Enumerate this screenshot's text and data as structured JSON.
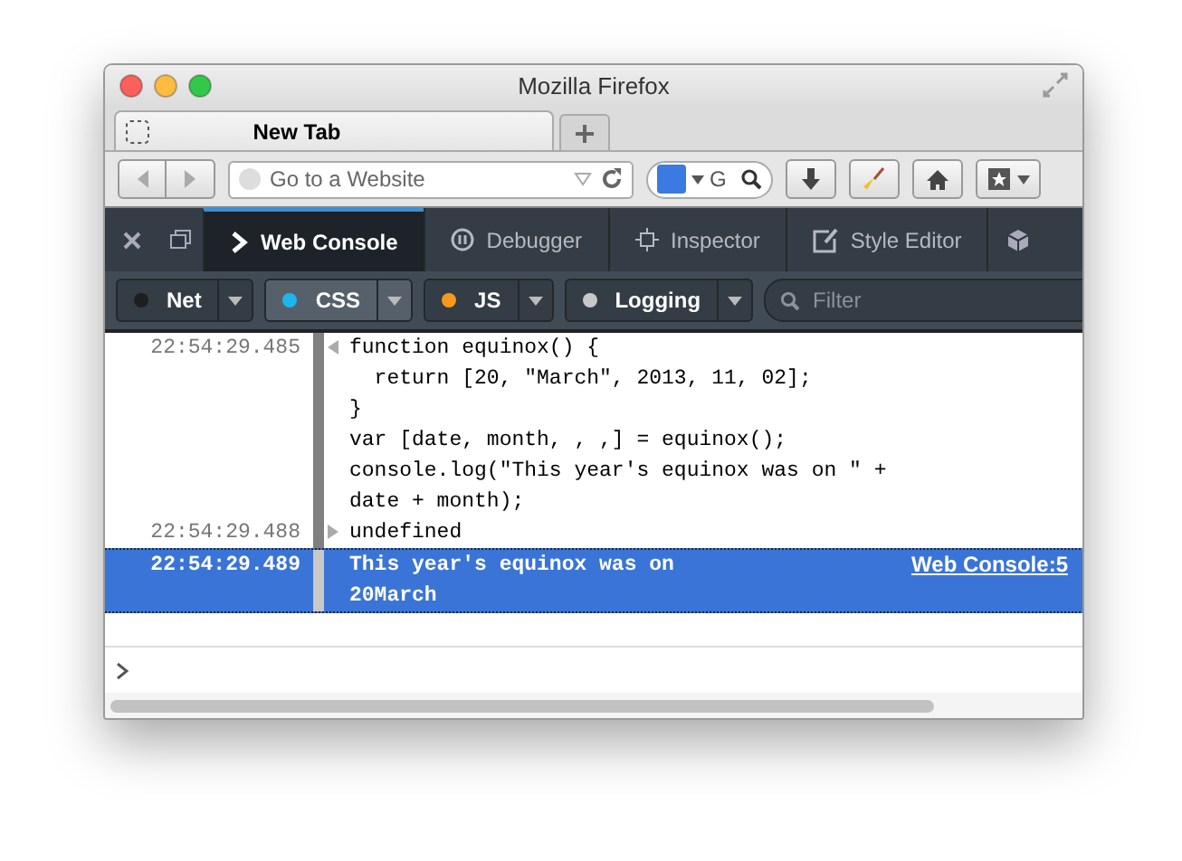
{
  "window": {
    "title": "Mozilla Firefox"
  },
  "tabs": [
    {
      "label": "New Tab",
      "selected": true
    }
  ],
  "navbar": {
    "address": {
      "placeholder": "Go to a Website"
    },
    "search": {
      "value": "G"
    }
  },
  "devtools_tabs": [
    {
      "label": "Web Console",
      "kind": "console",
      "selected": true
    },
    {
      "label": "Debugger",
      "kind": "debugger",
      "selected": false
    },
    {
      "label": "Inspector",
      "kind": "inspector",
      "selected": false
    },
    {
      "label": "Style Editor",
      "kind": "style",
      "selected": false
    }
  ],
  "filters": [
    {
      "label": "Net",
      "color": "#1e1e1e",
      "selected": false
    },
    {
      "label": "CSS",
      "color": "#1eb4f0",
      "selected": true
    },
    {
      "label": "JS",
      "color": "#f59a1a",
      "selected": false
    },
    {
      "label": "Logging",
      "color": "#c8c8c8",
      "selected": false
    }
  ],
  "filter_field": {
    "placeholder": "Filter"
  },
  "console": [
    {
      "kind": "input",
      "time": "22:54:29.485",
      "selected": false,
      "lines": [
        "function equinox() {",
        "  return [20, \"March\", 2013, 11, 02];",
        "}",
        "var [date, month, , ,] = equinox();",
        "console.log(\"This year's equinox was on \" +",
        "date + month);"
      ]
    },
    {
      "kind": "output",
      "time": "22:54:29.488",
      "selected": false,
      "lines": [
        "undefined"
      ]
    },
    {
      "kind": "log",
      "time": "22:54:29.489",
      "selected": true,
      "lines": [
        "This year's equinox was on 20March"
      ],
      "location": "Web Console:5"
    }
  ]
}
